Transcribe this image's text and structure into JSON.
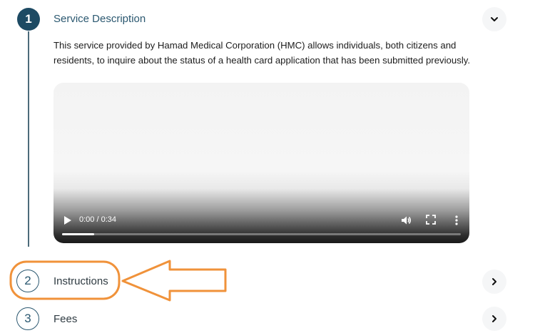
{
  "accent_color": "#1d4a63",
  "annotation_color": "#f0923a",
  "steps": [
    {
      "number": "1",
      "title": "Service Description",
      "state": "expanded",
      "chevron_icon": "chevron-down-icon"
    },
    {
      "number": "2",
      "title": "Instructions",
      "state": "collapsed",
      "chevron_icon": "chevron-right-icon"
    },
    {
      "number": "3",
      "title": "Fees",
      "state": "collapsed",
      "chevron_icon": "chevron-right-icon"
    }
  ],
  "service_description": {
    "text": "This service provided by Hamad Medical Corporation (HMC) allows individuals, both citizens and residents, to inquire about the status of a health card application that has been submitted previously."
  },
  "video": {
    "time_display": "0:00 / 0:34",
    "progress": 0.08,
    "icons": [
      "play-icon",
      "volume-icon",
      "fullscreen-icon",
      "more-options-icon"
    ]
  }
}
